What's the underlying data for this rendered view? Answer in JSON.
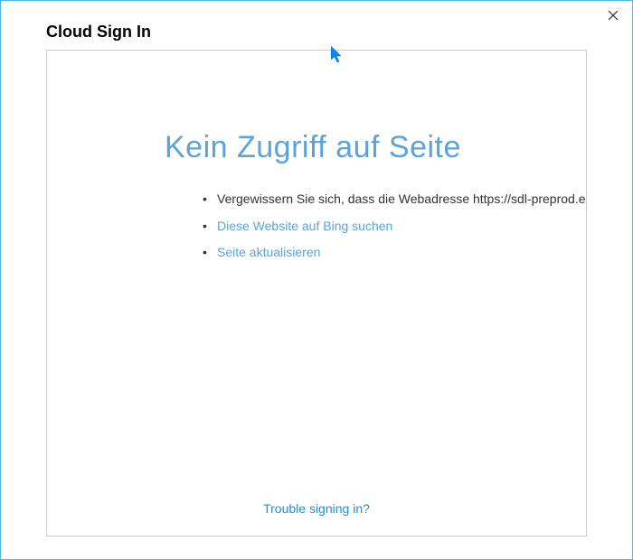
{
  "window": {
    "title": "Cloud Sign In"
  },
  "error": {
    "heading": "Kein Zugriff auf Seite",
    "items": [
      {
        "text": "Vergewissern Sie sich, dass die Webadresse https://sdl-preprod.eu",
        "is_link": false
      },
      {
        "text": "Diese Website auf Bing suchen",
        "is_link": true
      },
      {
        "text": "Seite aktualisieren",
        "is_link": true
      }
    ]
  },
  "footer": {
    "trouble_link": "Trouble signing in?"
  }
}
